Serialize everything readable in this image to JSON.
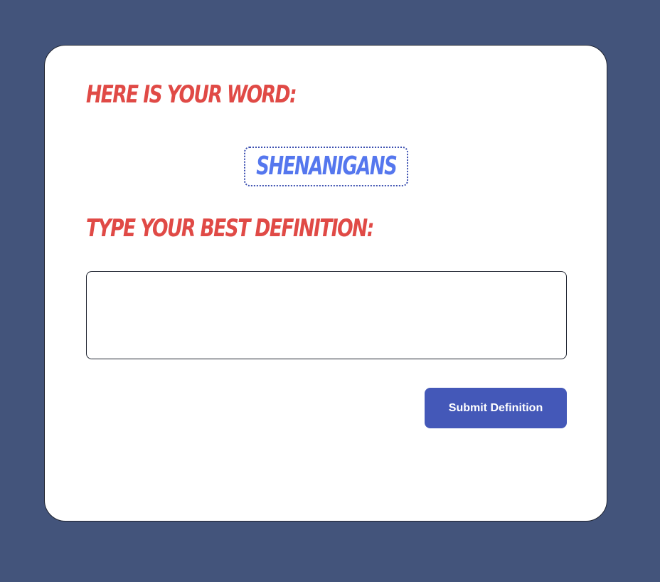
{
  "prompt": {
    "word_heading": "Here is your word:",
    "word": "Shenanigans",
    "definition_heading": "Type your best definition:"
  },
  "definition": {
    "value": "",
    "placeholder": ""
  },
  "actions": {
    "submit_label": "Submit Definition"
  },
  "colors": {
    "background": "#43547b",
    "heading": "#e04a46",
    "word": "#5577ee",
    "button": "#4458b8"
  }
}
